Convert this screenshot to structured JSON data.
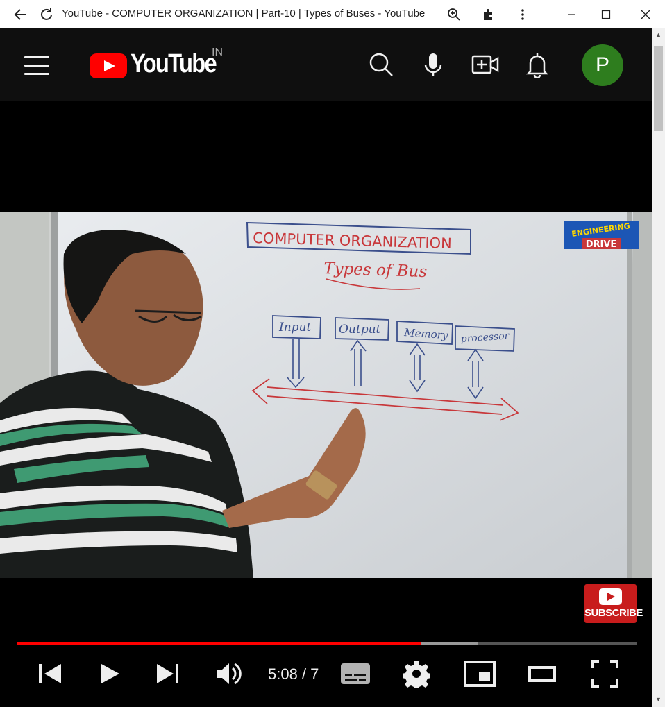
{
  "window": {
    "title": "YouTube - COMPUTER ORGANIZATION | Part-10 | Types of Buses - YouTube"
  },
  "masthead": {
    "logo_text": "YouTube",
    "country_code": "IN",
    "avatar_letter": "P",
    "avatar_color": "#2e7d1e",
    "brand_color": "#ff0000"
  },
  "video": {
    "whiteboard": {
      "heading": "COMPUTER ORGANIZATION",
      "subheading": "Types of Bus",
      "boxes": [
        "Input",
        "Output",
        "Memory",
        "processor"
      ]
    },
    "watermark": {
      "line1": "ENGINEERING",
      "line2": "DRIVE"
    }
  },
  "player": {
    "subscribe_label": "SUBSCRIBE",
    "time_display": "5:08 / 7",
    "played_fraction": 0.653,
    "buffered_fraction": 0.745,
    "icons": [
      "previous-icon",
      "play-icon",
      "next-icon",
      "volume-icon",
      "captions-icon",
      "settings-icon",
      "miniplayer-icon",
      "theater-icon",
      "fullscreen-icon"
    ]
  }
}
